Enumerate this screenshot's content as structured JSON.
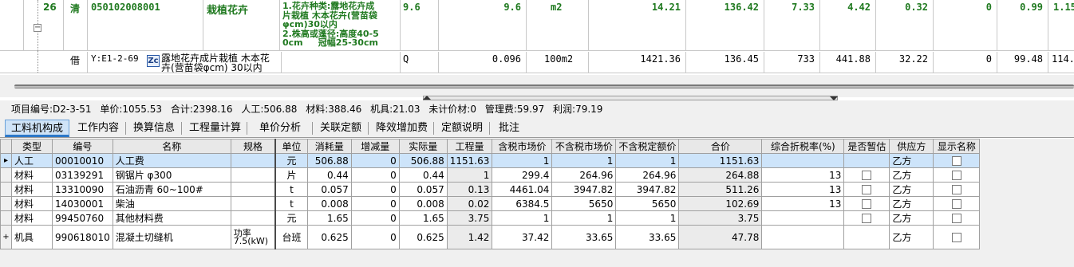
{
  "top_grid": {
    "row1": {
      "seq": "26",
      "type": "清",
      "code": "050102008001",
      "name": "栽植花卉",
      "desc_lines": [
        "1.花卉种类:露地花卉成",
        "片栽植 木本花卉(营苗袋",
        "φcm)30以内",
        "2.株高或蓬径:高度40-5",
        "0cm     冠幅25-30cm"
      ],
      "qty": "9.6",
      "qty2": "9.6",
      "unit": "m2",
      "v1": "14.21",
      "v2": "136.42",
      "v3": "7.33",
      "v4": "4.42",
      "v5": "0.32",
      "v6": "0",
      "v7": "0.99",
      "v8": "1.15"
    },
    "row2": {
      "type": "借",
      "code": "Y:E1-2-69",
      "icon_label": "Zc",
      "name_lines": [
        "露地花卉成片栽植 木本花",
        "卉(营苗袋φcm) 30以内"
      ],
      "q": "Q",
      "qty": "0.096",
      "unit": "100m2",
      "v1": "1421.36",
      "v2": "136.45",
      "v3": "733",
      "v4": "441.88",
      "v5": "32.22",
      "v6": "0",
      "v7": "99.48",
      "v8": "114.78"
    }
  },
  "info_bar": {
    "item_no": "项目编号:D2-3-51",
    "unit_price": "单价:1055.53",
    "total": "合计:2398.16",
    "labor": "人工:506.88",
    "material": "材料:388.46",
    "machine": "机具:21.03",
    "unpriced": "未计价材:0",
    "mgmt": "管理费:59.97",
    "profit": "利润:79.19"
  },
  "tabs": [
    "工料机构成",
    "工作内容",
    "换算信息",
    "工程量计算",
    "单价分析",
    "关联定额",
    "降效增加费",
    "定额说明",
    "批注"
  ],
  "table": {
    "headers": [
      "类型",
      "编号",
      "名称",
      "规格",
      "单位",
      "消耗量",
      "增减量",
      "实际量",
      "工程量",
      "含税市场价",
      "不含税市场价",
      "不含税定额价",
      "合价",
      "综合折税率(%)",
      "是否暂估",
      "供应方",
      "显示名称"
    ],
    "rows": [
      {
        "ind": "▸",
        "type": "人工",
        "code": "00010010",
        "name": "人工费",
        "spec": "",
        "unit": "元",
        "consume": "506.88",
        "delta": "0",
        "actual": "506.88",
        "qty": "1151.63",
        "tax_price": "1",
        "notax_price": "1",
        "notax_quota": "1",
        "total": "1151.63",
        "rate": "",
        "estimate": false,
        "supplier": "乙方",
        "show": false
      },
      {
        "ind": "",
        "type": "材料",
        "code": "03139291",
        "name": "钢锯片 φ300",
        "spec": "",
        "unit": "片",
        "consume": "0.44",
        "delta": "0",
        "actual": "0.44",
        "qty": "1",
        "tax_price": "299.4",
        "notax_price": "264.96",
        "notax_quota": "264.96",
        "total": "264.88",
        "rate": "13",
        "estimate": true,
        "supplier": "乙方",
        "show": true
      },
      {
        "ind": "",
        "type": "材料",
        "code": "13310090",
        "name": "石油沥青 60~100#",
        "spec": "",
        "unit": "t",
        "consume": "0.057",
        "delta": "0",
        "actual": "0.057",
        "qty": "0.13",
        "tax_price": "4461.04",
        "notax_price": "3947.82",
        "notax_quota": "3947.82",
        "total": "511.26",
        "rate": "13",
        "estimate": true,
        "supplier": "乙方",
        "show": true
      },
      {
        "ind": "",
        "type": "材料",
        "code": "14030001",
        "name": "柴油",
        "spec": "",
        "unit": "t",
        "consume": "0.008",
        "delta": "0",
        "actual": "0.008",
        "qty": "0.02",
        "tax_price": "6384.5",
        "notax_price": "5650",
        "notax_quota": "5650",
        "total": "102.69",
        "rate": "13",
        "estimate": true,
        "supplier": "乙方",
        "show": true
      },
      {
        "ind": "",
        "type": "材料",
        "code": "99450760",
        "name": "其他材料费",
        "spec": "",
        "unit": "元",
        "consume": "1.65",
        "delta": "0",
        "actual": "1.65",
        "qty": "3.75",
        "tax_price": "1",
        "notax_price": "1",
        "notax_quota": "1",
        "total": "3.75",
        "rate": "",
        "estimate": true,
        "supplier": "乙方",
        "show": true
      },
      {
        "ind": "+",
        "type": "机具",
        "code": "990618010",
        "name": "混凝土切缝机",
        "spec": "功率\n7.5(kW)",
        "unit": "台班",
        "consume": "0.625",
        "delta": "0",
        "actual": "0.625",
        "qty": "1.42",
        "tax_price": "37.42",
        "notax_price": "33.65",
        "notax_quota": "33.65",
        "total": "47.78",
        "rate": "",
        "estimate": false,
        "supplier": "乙方",
        "show": true
      }
    ]
  }
}
